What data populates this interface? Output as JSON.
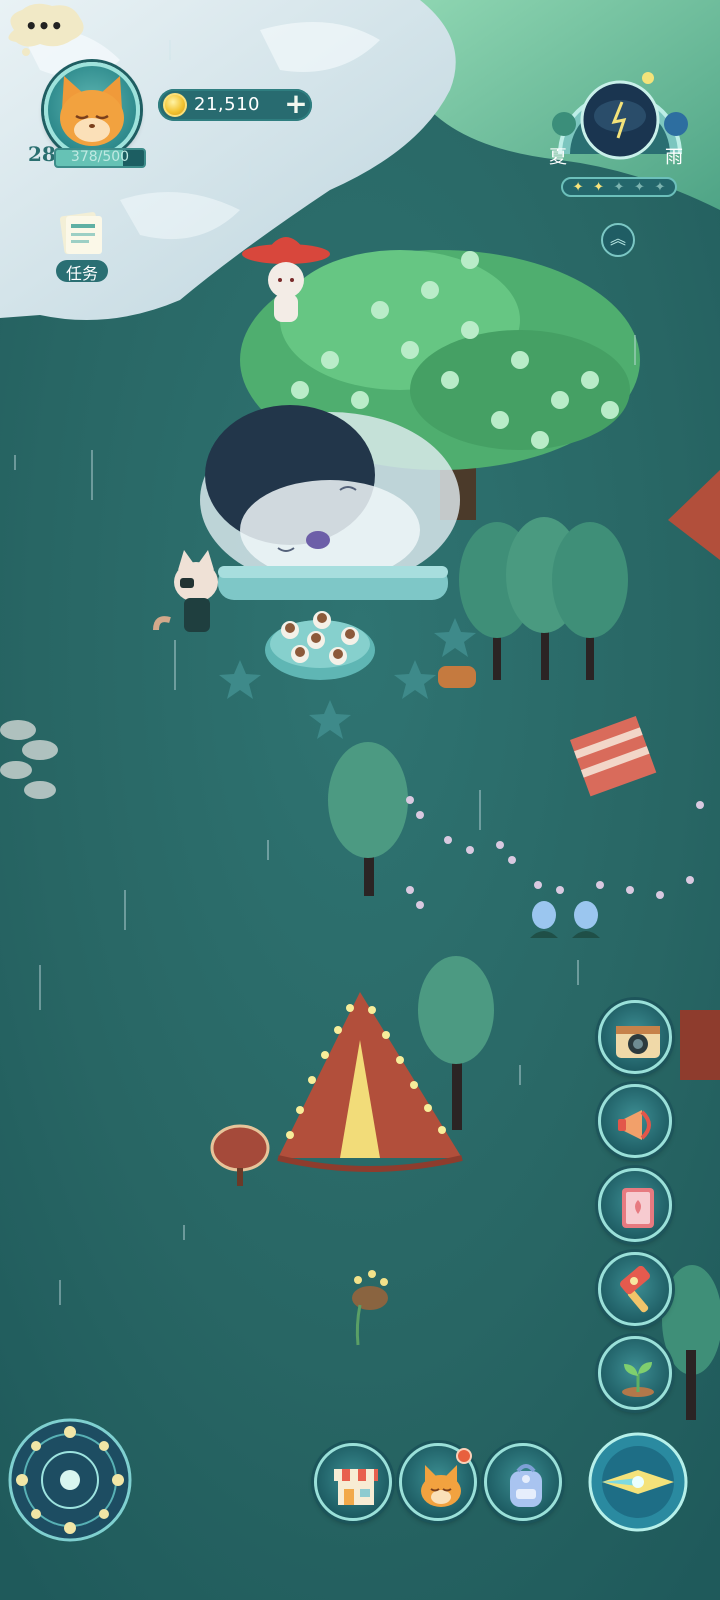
{
  "player": {
    "level": "28",
    "exp_text": "378/500",
    "exp_fraction": 0.756,
    "avatar_icon": "fox-avatar-icon"
  },
  "currency": {
    "coins": "21,510",
    "add_label": "+"
  },
  "quest": {
    "label": "任务"
  },
  "weather": {
    "season": "夏",
    "condition": "雨",
    "stars_total": 5,
    "stars_filled": 2,
    "star_filled_glyph": "✦",
    "star_empty_glyph": "✦",
    "expand_glyph": "︽"
  },
  "npc": {
    "speech": "•••"
  },
  "side_tools": [
    {
      "icon": "camera-icon"
    },
    {
      "icon": "megaphone-icon"
    },
    {
      "icon": "book-icon"
    },
    {
      "icon": "hammer-icon"
    },
    {
      "icon": "sprout-icon"
    }
  ],
  "bottom_bar": [
    {
      "icon": "shop-icon"
    },
    {
      "icon": "fox-friend-icon",
      "notification": true
    },
    {
      "icon": "backpack-icon"
    }
  ],
  "colors": {
    "ground": "#2b6b6a",
    "snow": "#d9e9ee",
    "accent": "#9ae0d9",
    "coin": "#f3c535",
    "notify": "#e8603e"
  }
}
